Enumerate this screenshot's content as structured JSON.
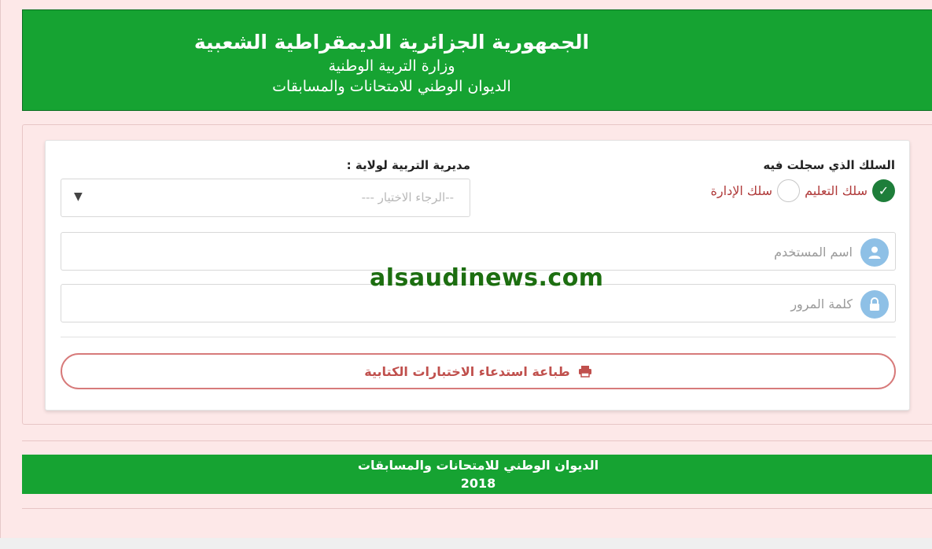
{
  "header": {
    "title": "الجمهورية الجزائرية الديمقراطية الشعبية",
    "ministry": "وزارة التربية الوطنية",
    "office": "الديوان الوطني للامتحانات والمسابقات"
  },
  "form": {
    "corps_label": "السلك الذي سجلت فيه",
    "corps_options": [
      {
        "label": "سلك التعليم",
        "selected": true
      },
      {
        "label": "سلك الإدارة",
        "selected": false
      }
    ],
    "directorate_label": "مديرية التربية لولاية :",
    "directorate_placeholder": "--الرجاء الاختيار ---",
    "username_placeholder": "اسم المستخدم",
    "password_placeholder": "كلمة المرور",
    "print_button_label": "طباعة استدعاء الاختبارات الكتابية"
  },
  "watermark": "alsaudinews.com",
  "footer": {
    "office": "الديوان الوطني للامتحانات والمسابقات",
    "year": "2018"
  },
  "colors": {
    "banner_green": "#16a332",
    "check_green": "#1e7e3a",
    "accent_red": "#c0504d",
    "icon_blue": "#8ec0e6"
  }
}
